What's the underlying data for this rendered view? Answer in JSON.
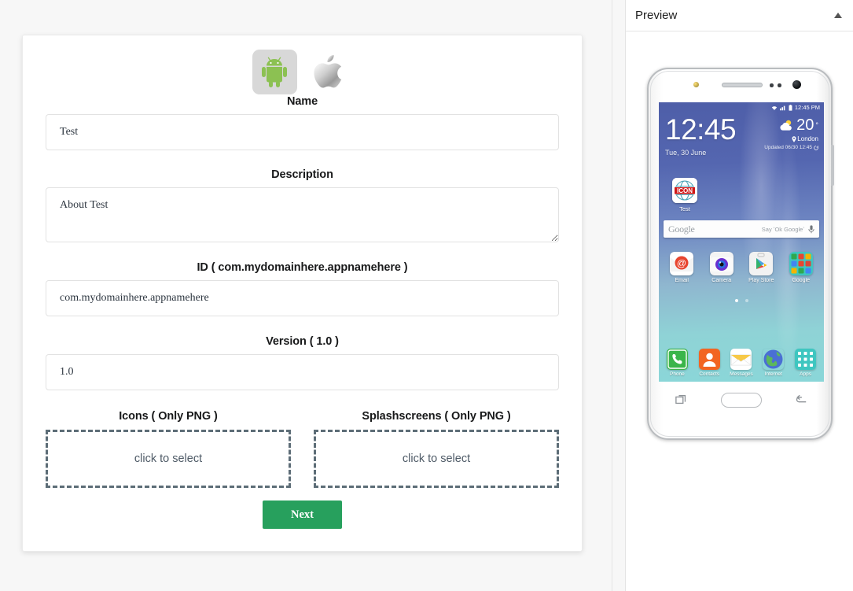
{
  "platforms": [
    {
      "name": "android",
      "label": "Android",
      "selected": true
    },
    {
      "name": "ios",
      "label": "iOS / Apple",
      "selected": false
    }
  ],
  "form": {
    "name": {
      "label": "Name",
      "value": "Test",
      "placeholder": "Name"
    },
    "description": {
      "label": "Description",
      "value": "About Test",
      "placeholder": "Description"
    },
    "id": {
      "label": "ID ( com.mydomainhere.appnamehere )",
      "value": "com.mydomainhere.appnamehere",
      "placeholder": "com.mydomainhere.appnamehere"
    },
    "version": {
      "label": "Version ( 1.0 )",
      "value": "1.0",
      "placeholder": "1.0"
    },
    "icons": {
      "label": "Icons ( Only PNG )",
      "drop_text": "click to select"
    },
    "splashscreens": {
      "label": "Splashscreens ( Only PNG )",
      "drop_text": "click to select"
    },
    "next_label": "Next",
    "next_color": "#27a05d"
  },
  "preview": {
    "title": "Preview",
    "collapse_icon": "triangle-up-icon",
    "phone": {
      "status_bar": {
        "time": "12:45 PM",
        "wifi_icon": "wifi-icon",
        "signal_icon": "signal-icon",
        "battery_icon": "battery-icon"
      },
      "clock": "12:45",
      "date": "Tue, 30 June",
      "weather": {
        "temp": "20",
        "degree": "°",
        "city": "London",
        "updated": "Updated 06/30 12:45",
        "icon": "partly-cloudy-icon"
      },
      "shortcut": {
        "label": "Test",
        "icon_text": "ICON"
      },
      "search": {
        "logo": "Google",
        "hint": "Say ʻOk Googleʼ",
        "mic_icon": "microphone-icon"
      },
      "apps": [
        {
          "label": "Email",
          "icon": "email-icon"
        },
        {
          "label": "Camera",
          "icon": "camera-icon"
        },
        {
          "label": "Play Store",
          "icon": "play-store-icon"
        },
        {
          "label": "Google",
          "icon": "google-folder-icon"
        }
      ],
      "page_dots": 2,
      "dock": [
        {
          "label": "Phone",
          "icon": "phone-icon"
        },
        {
          "label": "Contacts",
          "icon": "contacts-icon"
        },
        {
          "label": "Messages",
          "icon": "messages-icon"
        },
        {
          "label": "Internet",
          "icon": "internet-icon"
        },
        {
          "label": "Apps",
          "icon": "apps-grid-icon"
        }
      ],
      "nav": {
        "recents_icon": "recents-icon",
        "home_icon": "home-button",
        "back_icon": "back-icon"
      }
    }
  }
}
